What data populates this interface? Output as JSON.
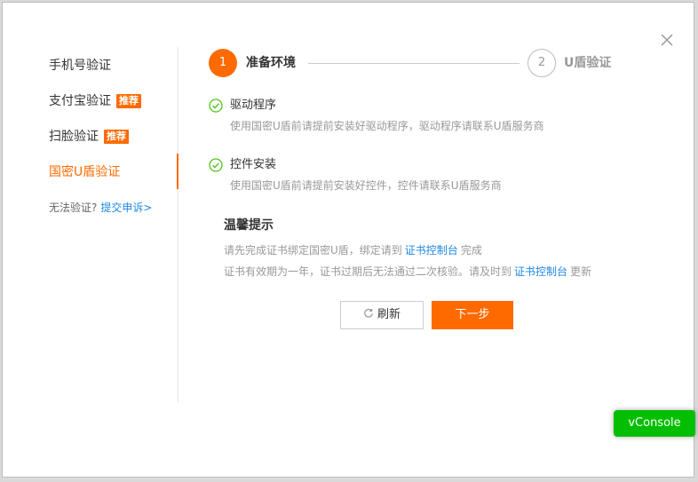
{
  "sidebar": {
    "items": [
      {
        "label": "手机号验证"
      },
      {
        "label": "支付宝验证",
        "badge": "推荐"
      },
      {
        "label": "扫脸验证",
        "badge": "推荐"
      },
      {
        "label": "国密U盾验证",
        "active": true
      }
    ],
    "help_text": "无法验证?",
    "help_link": "提交申诉>"
  },
  "stepper": {
    "steps": [
      {
        "number": "1",
        "label": "准备环境"
      },
      {
        "number": "2",
        "label": "U盾验证"
      }
    ]
  },
  "checks": [
    {
      "title": "驱动程序",
      "desc": "使用国密U盾前请提前安装好驱动程序，驱动程序请联系U盾服务商"
    },
    {
      "title": "控件安装",
      "desc": "使用国密U盾前请提前安装好控件，控件请联系U盾服务商"
    }
  ],
  "tips": {
    "title": "温馨提示",
    "line1_pre": "请先完成证书绑定国密U盾，绑定请到",
    "line1_link": "证书控制台",
    "line1_post": "完成",
    "line2_pre": "证书有效期为一年，证书过期后无法通过二次核验。请及时到",
    "line2_link": "证书控制台",
    "line2_post": "更新"
  },
  "buttons": {
    "refresh": "刷新",
    "next": "下一步"
  },
  "vconsole": "vConsole",
  "colors": {
    "accent": "#ff6a00",
    "link": "#1e88e5",
    "success": "#52c41a",
    "vconsole": "#04be02"
  }
}
